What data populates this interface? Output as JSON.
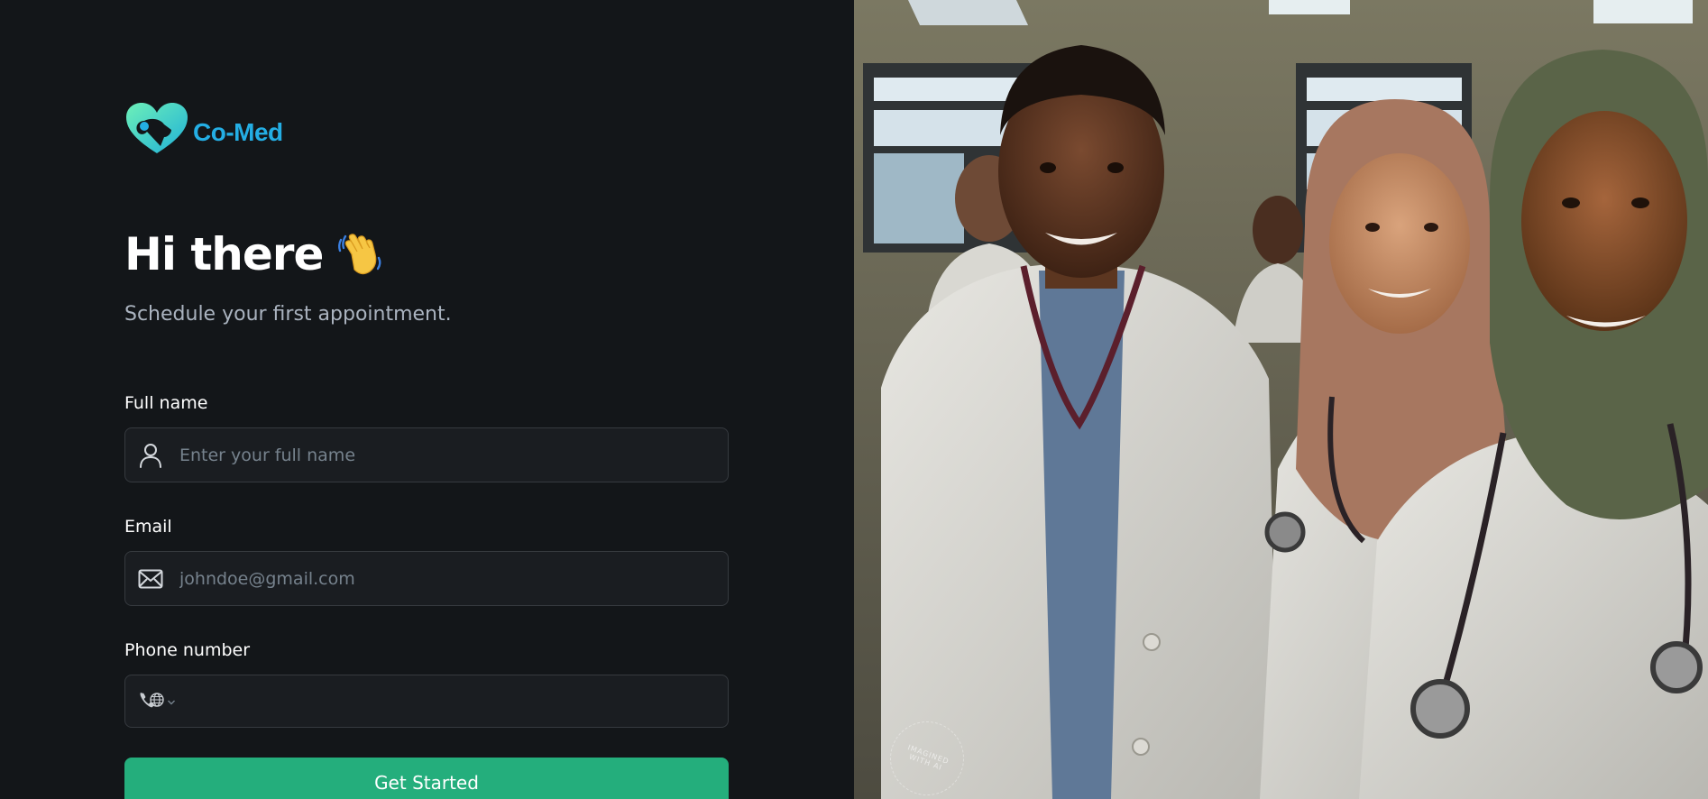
{
  "brand": {
    "name": "Co-Med",
    "logo_colors": {
      "teal": "#5ee0b0",
      "blue": "#24aee4"
    }
  },
  "greeting": {
    "title": "Hi there",
    "emoji": "👋",
    "subtitle": "Schedule your first appointment."
  },
  "form": {
    "full_name": {
      "label": "Full name",
      "placeholder": "Enter your full name",
      "value": "",
      "icon": "user-icon"
    },
    "email": {
      "label": "Email",
      "placeholder": "johndoe@gmail.com",
      "value": "",
      "icon": "mail-icon"
    },
    "phone": {
      "label": "Phone number",
      "value": "",
      "country_icon": "international-phone-icon"
    },
    "submit_label": "Get Started"
  },
  "hero_image": {
    "watermark": "IMAGINED WITH AI"
  },
  "colors": {
    "background": "#131619",
    "input_background": "#1a1d21",
    "input_border": "#363a3f",
    "primary_button": "#24ae7c",
    "brand_blue": "#24aee4",
    "subtitle_text": "#aab3bf",
    "placeholder_text": "#76828d"
  }
}
